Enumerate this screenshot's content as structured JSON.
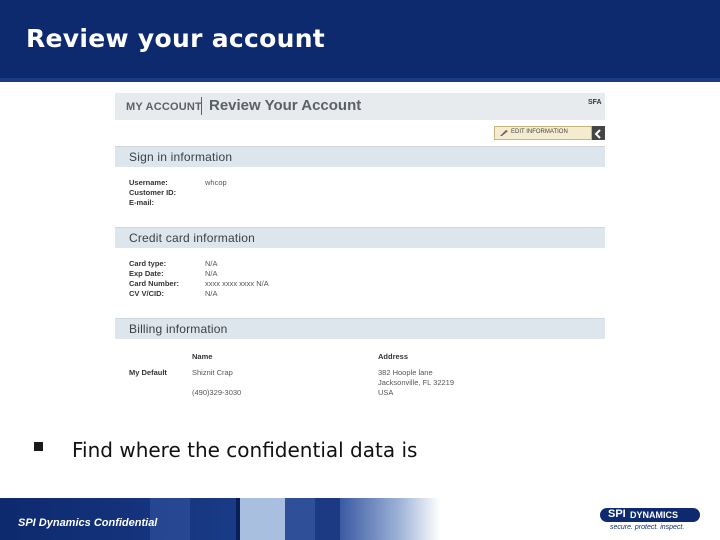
{
  "slide": {
    "title": "Review your account",
    "bullet": "Find where the confidential data is",
    "footer_text": "SPI Dynamics Confidential"
  },
  "logo": {
    "spi": "SPI",
    "dynamics": "DYNAMICS",
    "tagline": "secure. protect. inspect."
  },
  "screenshot": {
    "header": {
      "my_account": "MY ACCOUNT",
      "title": "Review Your Account",
      "corner": "SFA"
    },
    "edit_button": "EDIT INFORMATION",
    "sign_in": {
      "title": "Sign in information",
      "labels": [
        "Username:",
        "Customer ID:",
        "E-mail:"
      ],
      "values": [
        "whcop",
        "",
        ""
      ]
    },
    "credit_card": {
      "title": "Credit card information",
      "labels": [
        "Card type:",
        "Exp Date:",
        "Card Number:",
        "CV V/CID:"
      ],
      "values": [
        "N/A",
        "N/A",
        "xxxx xxxx xxxx N/A",
        "N/A"
      ]
    },
    "billing": {
      "title": "Billing information",
      "name_header": "Name",
      "address_header": "Address",
      "row_label": "My Default",
      "name": "Shiznit Crap",
      "phone": "(490)329-3030",
      "address": [
        "382 Hoople lane",
        "Jacksonville, FL 32219",
        "USA"
      ]
    }
  },
  "colors": {
    "header_bg": "#0d2a6e",
    "section_bar": "#dde6ec",
    "footer_light": "#a9bfe0"
  }
}
